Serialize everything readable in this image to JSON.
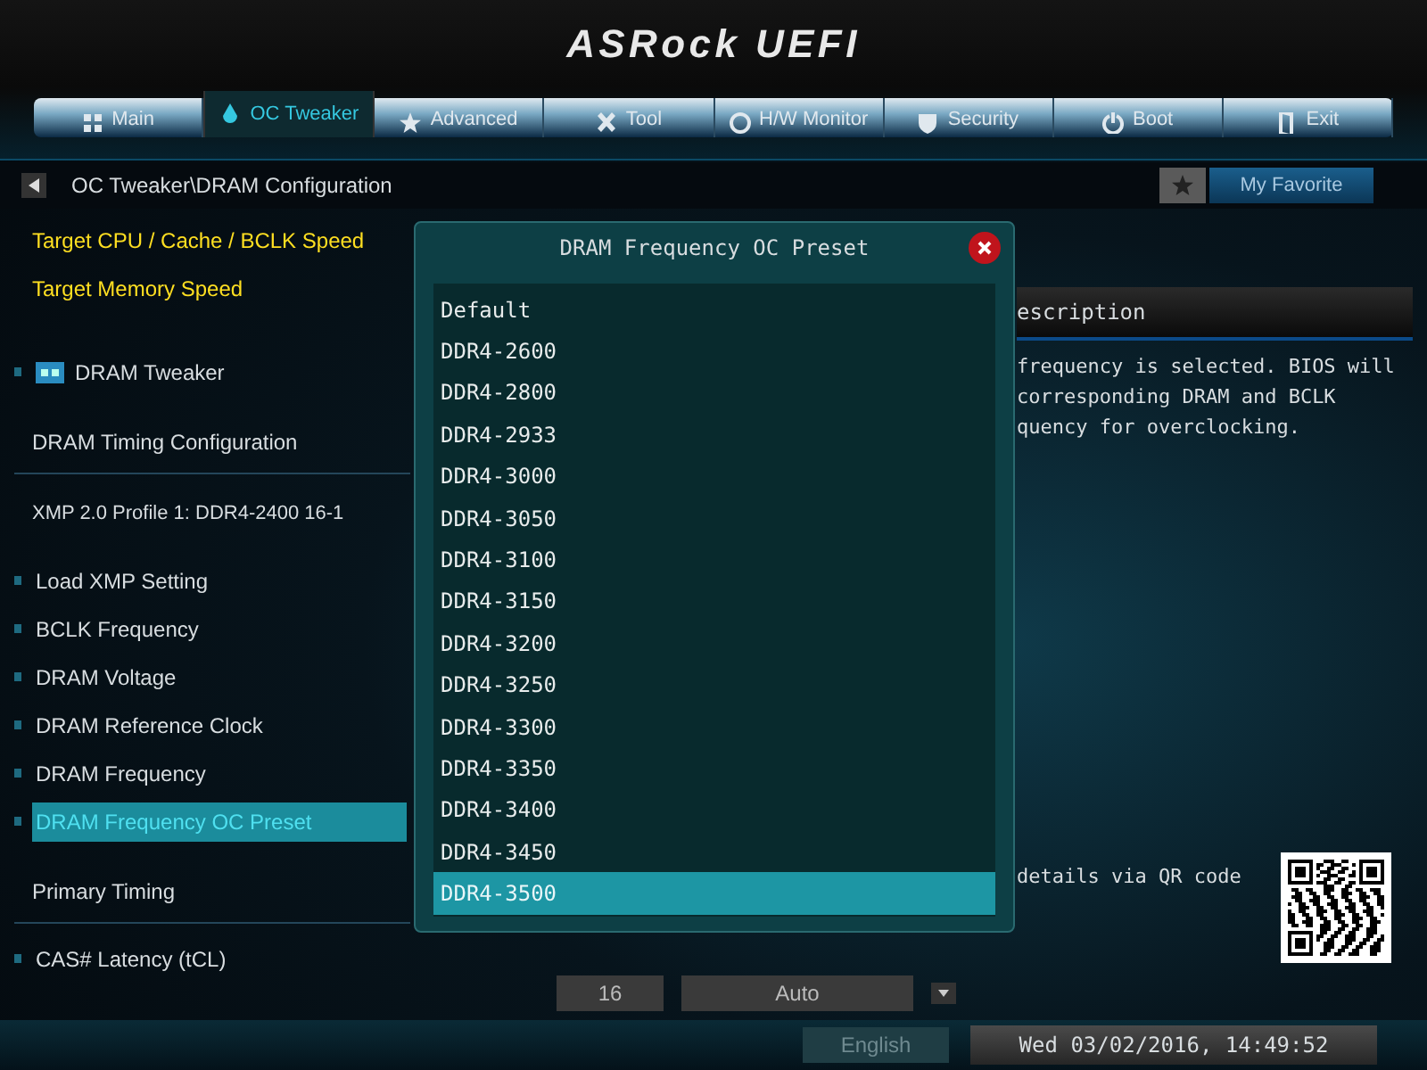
{
  "header": {
    "logo": "ASRock UEFI"
  },
  "tabs": [
    {
      "label": "Main",
      "selected": false
    },
    {
      "label": "OC Tweaker",
      "selected": true
    },
    {
      "label": "Advanced",
      "selected": false
    },
    {
      "label": "Tool",
      "selected": false
    },
    {
      "label": "H/W Monitor",
      "selected": false
    },
    {
      "label": "Security",
      "selected": false
    },
    {
      "label": "Boot",
      "selected": false
    },
    {
      "label": "Exit",
      "selected": false
    }
  ],
  "breadcrumb": "OC Tweaker\\DRAM Configuration",
  "favorite": {
    "label": "My Favorite"
  },
  "settings": [
    {
      "kind": "info",
      "label": "Target CPU / Cache / BCLK Speed"
    },
    {
      "kind": "info",
      "label": "Target Memory Speed"
    },
    {
      "kind": "submenu",
      "label": "DRAM Tweaker",
      "selected": false
    },
    {
      "kind": "heading",
      "label": "DRAM Timing Configuration"
    },
    {
      "kind": "note",
      "label": "XMP 2.0 Profile 1: DDR4-2400 16-1"
    },
    {
      "kind": "option",
      "label": "Load XMP Setting",
      "selected": false
    },
    {
      "kind": "option",
      "label": "BCLK Frequency",
      "selected": false
    },
    {
      "kind": "option",
      "label": "DRAM Voltage",
      "selected": false
    },
    {
      "kind": "option",
      "label": "DRAM Reference Clock",
      "selected": false
    },
    {
      "kind": "option",
      "label": "DRAM Frequency",
      "selected": false
    },
    {
      "kind": "option",
      "label": "DRAM Frequency OC Preset",
      "selected": true
    },
    {
      "kind": "heading",
      "label": "Primary Timing"
    },
    {
      "kind": "value",
      "label": "CAS# Latency (tCL)",
      "value": "16",
      "option": "Auto",
      "selected": false
    }
  ],
  "description": {
    "title": "escription",
    "lines": [
      "frequency is selected. BIOS will",
      "corresponding DRAM and BCLK",
      "quency for overclocking."
    ],
    "qr_caption": "details via QR code"
  },
  "dialog": {
    "title": "DRAM Frequency OC Preset",
    "options": [
      {
        "label": "Default",
        "selected": false
      },
      {
        "label": "DDR4-2600",
        "selected": false
      },
      {
        "label": "DDR4-2800",
        "selected": false
      },
      {
        "label": "DDR4-2933",
        "selected": false
      },
      {
        "label": "DDR4-3000",
        "selected": false
      },
      {
        "label": "DDR4-3050",
        "selected": false
      },
      {
        "label": "DDR4-3100",
        "selected": false
      },
      {
        "label": "DDR4-3150",
        "selected": false
      },
      {
        "label": "DDR4-3200",
        "selected": false
      },
      {
        "label": "DDR4-3250",
        "selected": false
      },
      {
        "label": "DDR4-3300",
        "selected": false
      },
      {
        "label": "DDR4-3350",
        "selected": false
      },
      {
        "label": "DDR4-3400",
        "selected": false
      },
      {
        "label": "DDR4-3450",
        "selected": false
      },
      {
        "label": "DDR4-3500",
        "selected": true
      }
    ]
  },
  "status_bar": {
    "language": "English",
    "datetime": "Wed 03/02/2016, 14:49:52"
  }
}
